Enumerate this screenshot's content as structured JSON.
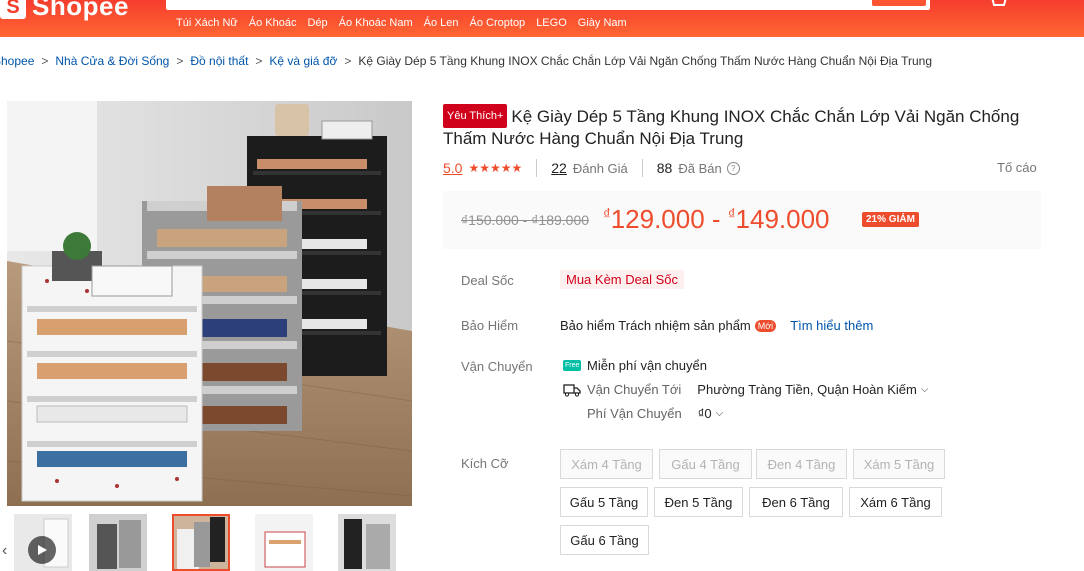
{
  "header": {
    "logo_text": "Shopee",
    "logo_glyph": "S",
    "search_hints": [
      "Túi Xách Nữ",
      "Áo Khoác",
      "Dép",
      "Áo Khoác Nam",
      "Áo Len",
      "Áo Croptop",
      "LEGO",
      "Giày Nam"
    ]
  },
  "breadcrumb": [
    "Shopee",
    "Nhà Cửa & Đời Sống",
    "Đồ nội thất",
    "Kệ và giá đỡ",
    "Kệ Giày Dép 5 Tầng Khung INOX Chắc Chắn Lớp Vải Ngăn Chống Thấm Nước Hàng Chuẩn Nội Địa Trung"
  ],
  "product": {
    "badge": "Yêu Thích+",
    "title": "Kệ Giày Dép 5 Tầng Khung INOX Chắc Chắn Lớp Vải Ngăn Chống Thấm Nước Hàng Chuẩn Nội Địa Trung",
    "rating": "5.0",
    "stars": "★★★★★",
    "review_count": "22",
    "review_label": "Đánh Giá",
    "sold_count": "88",
    "sold_label": "Đã Bán",
    "report": "Tố cáo",
    "old_price": "₫150.000 - ₫189.000",
    "currency": "₫",
    "price_min": "129.000",
    "price_sep": "-",
    "price_max": "149.000",
    "discount": "21% GIẢM"
  },
  "details": {
    "deal_label": "Deal Sốc",
    "deal_value": "Mua Kèm Deal Sốc",
    "insurance_label": "Bảo Hiểm",
    "insurance_value": "Bảo hiểm Trách nhiệm sản phẩm",
    "insurance_new": "Mới",
    "insurance_more": "Tìm hiểu thêm",
    "shipping_label": "Vận Chuyển",
    "free_ship": "Miễn phí vận chuyển",
    "free_badge": "Free",
    "ship_to_label": "Vận Chuyển Tới",
    "ship_to_value": "Phường Tràng Tiền, Quận Hoàn Kiếm",
    "ship_fee_label": "Phí Vận Chuyển",
    "ship_fee_value": "₫0",
    "size_label": "Kích Cỡ"
  },
  "sizes": [
    {
      "label": "Xám 4 Tầng",
      "disabled": true
    },
    {
      "label": "Gấu 4 Tầng",
      "disabled": true
    },
    {
      "label": "Đen 4 Tầng",
      "disabled": true
    },
    {
      "label": "Xám 5 Tầng",
      "disabled": true
    },
    {
      "label": "Gấu 5 Tầng",
      "disabled": false
    },
    {
      "label": "Đen 5 Tầng",
      "disabled": false
    },
    {
      "label": "Đen 6 Tầng",
      "disabled": false
    },
    {
      "label": "Xám 6 Tầng",
      "disabled": false
    },
    {
      "label": "Gấu 6 Tầng",
      "disabled": false
    }
  ],
  "colors": {
    "brand": "#ee4d2d",
    "header": "#f53d2d",
    "link": "#0055aa"
  }
}
